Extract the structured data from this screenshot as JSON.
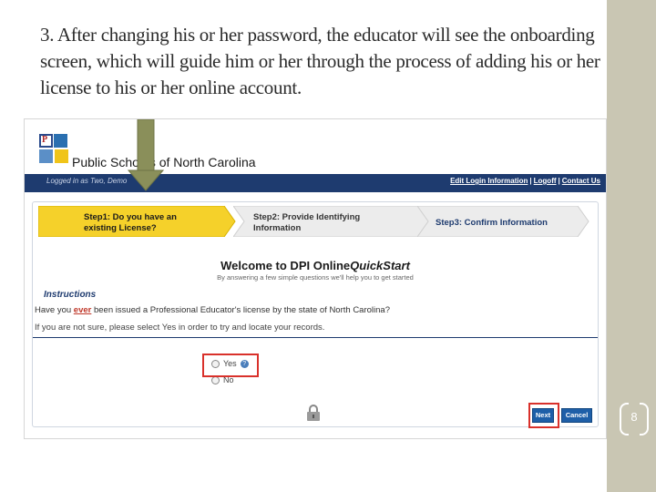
{
  "slide": {
    "title": "3. After changing his or her password, the educator will see the onboarding screen, which will guide him or her through the process of adding his or her license to his or her online account.",
    "page_number": "8"
  },
  "app": {
    "org_name": "Public Schools of North Carolina",
    "logged_in_text": "Logged in as Two, Demo",
    "nav_links": [
      "Edit Login Information",
      "Logoff",
      "Contact Us"
    ]
  },
  "steps": [
    {
      "line1": "Step1: Do you have an",
      "line2": "existing License?",
      "active": true
    },
    {
      "line1": "Step2: Provide Identifying",
      "line2": "Information",
      "active": false
    },
    {
      "line1": "Step3: Confirm Information",
      "line2": "",
      "active": false
    }
  ],
  "welcome": {
    "prefix": "Welcome to DPI Online",
    "emphasis": "QuickStart",
    "subtitle": "By answering a few simple questions we'll help you to get started"
  },
  "instructions": {
    "heading": "Instructions",
    "question_prefix": "Have you ",
    "question_emphasis": "ever",
    "question_suffix": " been issued a Professional Educator's license by the state of North Carolina?",
    "note": "If you are not sure, please select Yes in order to try and locate your records."
  },
  "options": [
    {
      "label": "Yes",
      "selected": false
    },
    {
      "label": "No",
      "selected": false
    }
  ],
  "buttons": {
    "next": "Next",
    "cancel": "Cancel"
  },
  "colors": {
    "side_panel": "#c9c6b3",
    "nav_bar": "#1e3b6f",
    "active_step": "#f5d12a",
    "inactive_step": "#ececec",
    "highlight_box": "#d9312b",
    "button": "#1e5fa8",
    "arrow": "#8a8f5a"
  },
  "icons": [
    "dpi-logo-icon",
    "help-icon",
    "lock-icon",
    "down-arrow-icon"
  ]
}
